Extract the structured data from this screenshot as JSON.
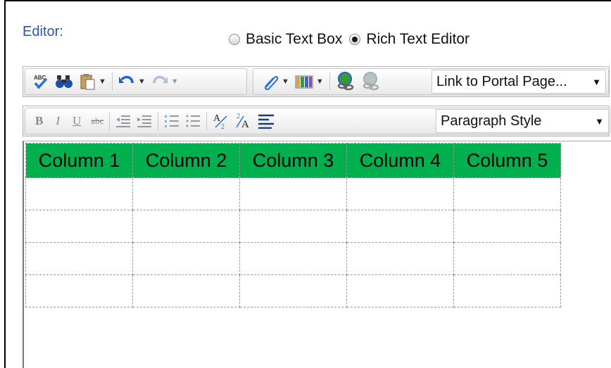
{
  "editor": {
    "label": "Editor:",
    "mode_options": [
      {
        "label": "Basic Text Box",
        "checked": false
      },
      {
        "label": "Rich Text Editor",
        "checked": true
      }
    ]
  },
  "toolbar1": {
    "link_dropdown": "Link to Portal Page..."
  },
  "toolbar2": {
    "style_dropdown": "Paragraph Style"
  },
  "table": {
    "header_color": "#00b04f",
    "columns": [
      "Column 1",
      "Column 2",
      "Column 3",
      "Column 4",
      "Column 5"
    ],
    "empty_rows": 4
  }
}
